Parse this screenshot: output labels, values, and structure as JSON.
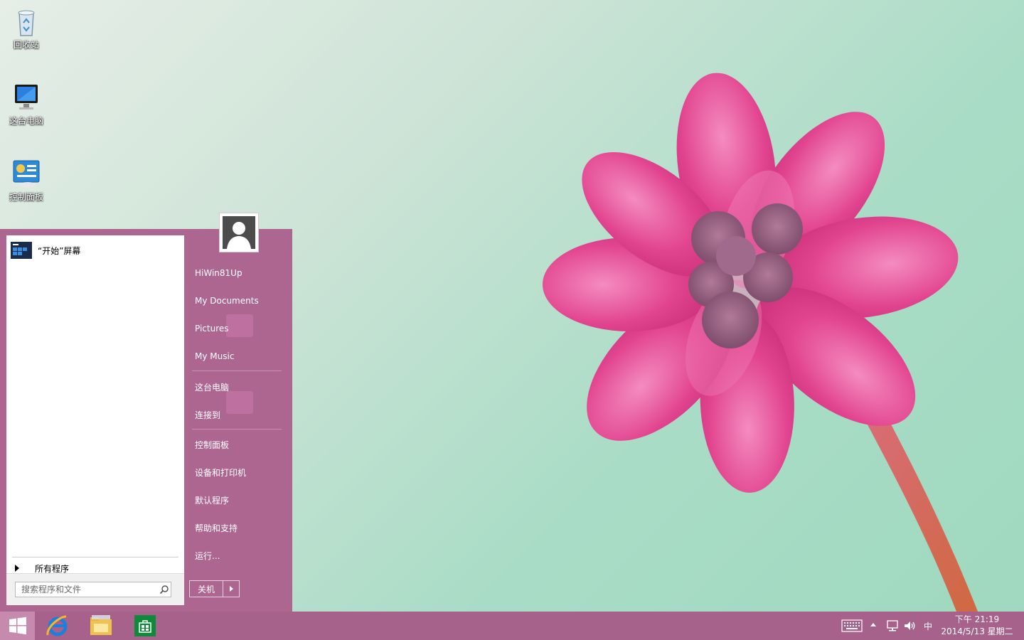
{
  "desktop": {
    "icons": [
      {
        "label": "回收站",
        "icon": "recycle-bin-icon"
      },
      {
        "label": "这台电脑",
        "icon": "computer-icon"
      },
      {
        "label": "控制面板",
        "icon": "control-panel-icon"
      }
    ]
  },
  "start_menu": {
    "pinned": [
      {
        "label": "“开始”屏幕",
        "icon": "start-screen-icon"
      }
    ],
    "all_programs_label": "所有程序",
    "search_placeholder": "搜索程序和文件",
    "user_name": "HiWin81Up",
    "right_items": [
      {
        "label": "My Documents"
      },
      {
        "label": "Pictures"
      },
      {
        "label": "My Music"
      },
      {
        "label": "这台电脑"
      },
      {
        "label": "连接到"
      },
      {
        "label": "控制面板"
      },
      {
        "label": "设备和打印机"
      },
      {
        "label": "默认程序"
      },
      {
        "label": "帮助和支持"
      },
      {
        "label": "运行..."
      }
    ],
    "shutdown_label": "关机"
  },
  "taskbar": {
    "apps": [
      {
        "name": "Internet Explorer",
        "icon": "ie-icon"
      },
      {
        "name": "File Explorer",
        "icon": "file-explorer-icon"
      },
      {
        "name": "Store",
        "icon": "store-icon"
      }
    ],
    "tray": {
      "ime_label": "中",
      "time": "下午 21:19",
      "date": "2014/5/13 星期二"
    }
  },
  "colors": {
    "accent": "#ac6690",
    "taskbar": "#a6628a",
    "start_button_highlight": "#c58aae",
    "wallpaper_green": "#a9dcc6",
    "flower_pink": "#e0438f"
  }
}
